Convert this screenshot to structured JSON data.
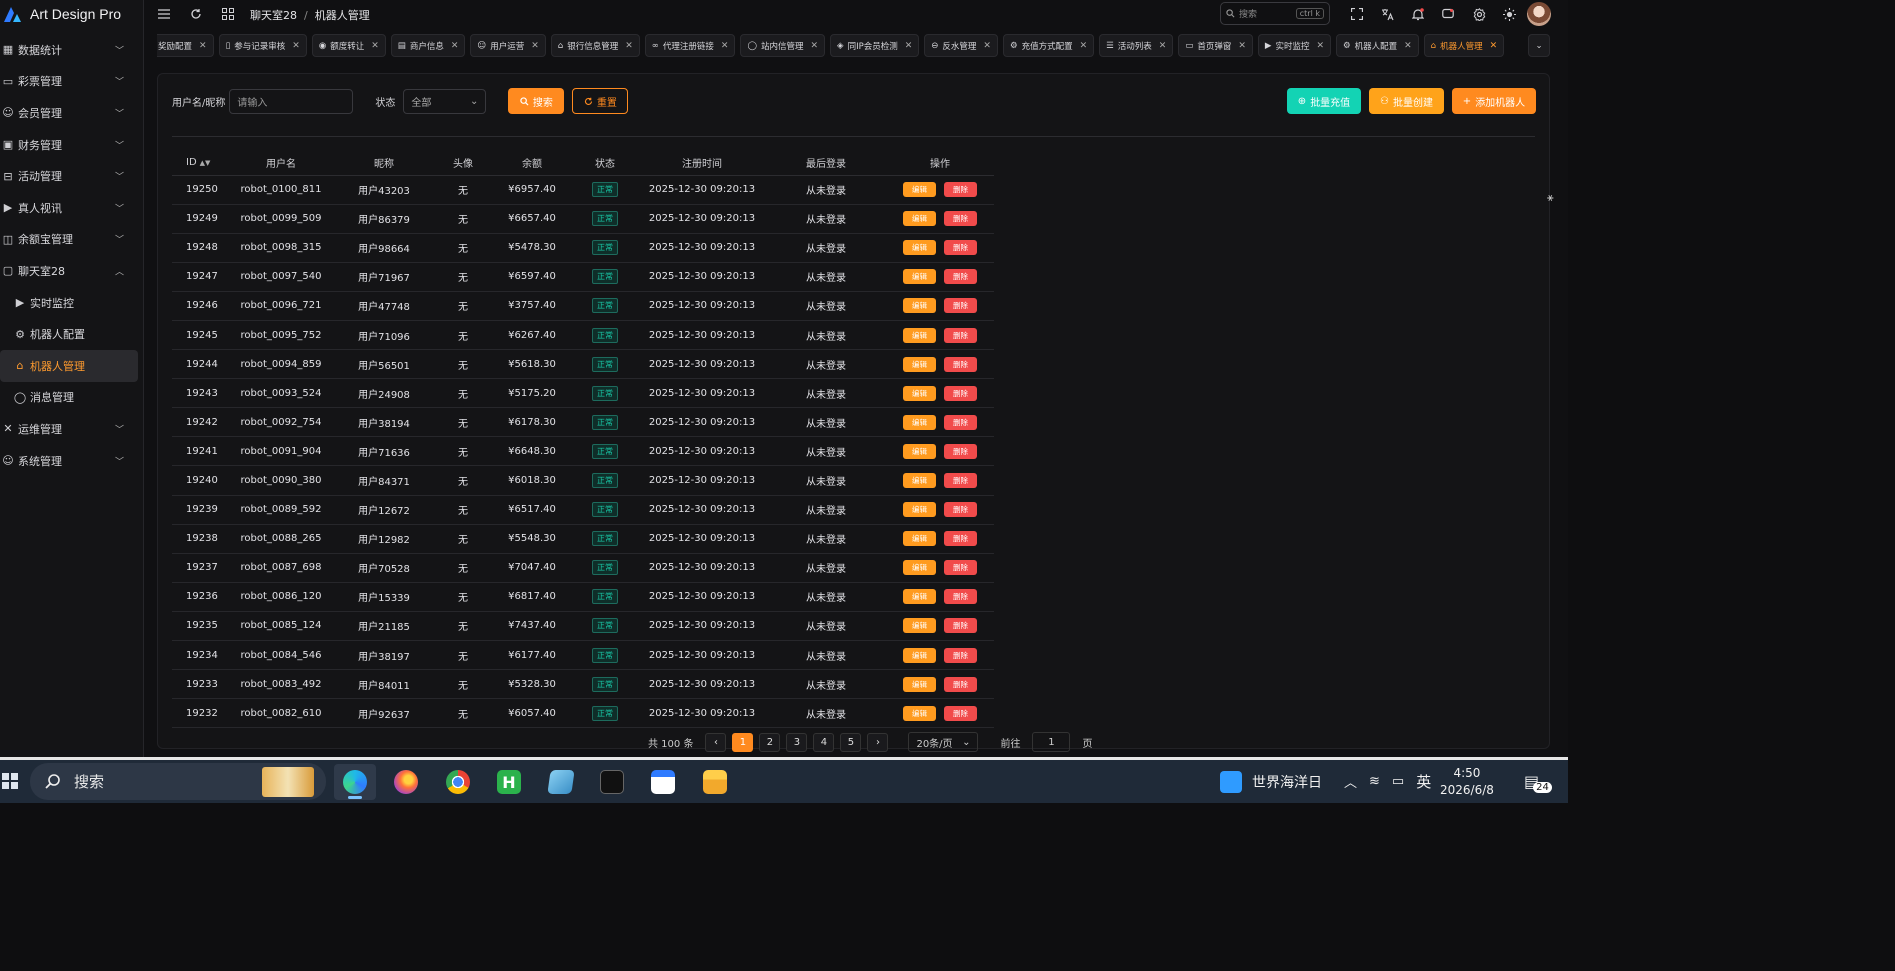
{
  "app": {
    "title": "Art Design Pro"
  },
  "sidebar": {
    "items": [
      {
        "label": "数据统计",
        "icon": "chart-icon",
        "expanded": false,
        "type": "group"
      },
      {
        "label": "彩票管理",
        "icon": "ticket-icon",
        "expanded": false,
        "type": "group"
      },
      {
        "label": "会员管理",
        "icon": "user-icon",
        "expanded": false,
        "type": "group"
      },
      {
        "label": "财务管理",
        "icon": "wallet-icon",
        "expanded": false,
        "type": "group"
      },
      {
        "label": "活动管理",
        "icon": "gift-icon",
        "expanded": false,
        "type": "group"
      },
      {
        "label": "真人视讯",
        "icon": "video-icon",
        "expanded": false,
        "type": "group"
      },
      {
        "label": "余额宝管理",
        "icon": "piggy-icon",
        "expanded": false,
        "type": "group"
      },
      {
        "label": "聊天室28",
        "icon": "chat-room-icon",
        "expanded": true,
        "type": "group"
      },
      {
        "label": "实时监控",
        "icon": "monitor-icon",
        "type": "sub"
      },
      {
        "label": "机器人配置",
        "icon": "gear-icon",
        "type": "sub"
      },
      {
        "label": "机器人管理",
        "icon": "robot-icon",
        "type": "sub",
        "active": true
      },
      {
        "label": "消息管理",
        "icon": "message-icon",
        "type": "sub"
      },
      {
        "label": "运维管理",
        "icon": "tools-icon",
        "expanded": false,
        "type": "group"
      },
      {
        "label": "系统管理",
        "icon": "system-user-icon",
        "expanded": false,
        "type": "group"
      }
    ]
  },
  "header": {
    "breadcrumb": [
      "聊天室28",
      "机器人管理"
    ],
    "search_placeholder": "搜索",
    "search_shortcut": "ctrl k"
  },
  "tabs": [
    {
      "label": "奖励配置",
      "icon": ""
    },
    {
      "label": "参与记录审核",
      "icon": "doc-icon"
    },
    {
      "label": "额度转让",
      "icon": "coin-icon"
    },
    {
      "label": "商户信息",
      "icon": "card-icon"
    },
    {
      "label": "用户运营",
      "icon": "user-icon"
    },
    {
      "label": "银行信息管理",
      "icon": "bank-icon"
    },
    {
      "label": "代理注册链接",
      "icon": "link-icon"
    },
    {
      "label": "站内信管理",
      "icon": "message-icon"
    },
    {
      "label": "同IP会员检测",
      "icon": "shield-icon"
    },
    {
      "label": "反水管理",
      "icon": "rebate-icon"
    },
    {
      "label": "充值方式配置",
      "icon": "gear-icon"
    },
    {
      "label": "活动列表",
      "icon": "list-icon"
    },
    {
      "label": "首页弹窗",
      "icon": "window-icon"
    },
    {
      "label": "实时监控",
      "icon": "monitor-icon"
    },
    {
      "label": "机器人配置",
      "icon": "gear-icon"
    },
    {
      "label": "机器人管理",
      "icon": "robot-icon",
      "active": true
    }
  ],
  "filters": {
    "username_label": "用户名/昵称",
    "username_placeholder": "请输入",
    "status_label": "状态",
    "status_value": "全部",
    "search_button": "搜索",
    "reset_button": "重置"
  },
  "actions": {
    "batch_recharge": "批量充值",
    "batch_create": "批量创建",
    "add_robot": "添加机器人"
  },
  "table": {
    "columns": [
      "ID",
      "用户名",
      "昵称",
      "头像",
      "余额",
      "状态",
      "注册时间",
      "最后登录",
      "操作"
    ],
    "edit_label": "编辑",
    "delete_label": "删除",
    "rows": [
      {
        "id": "19250",
        "username": "robot_0100_811",
        "nickname": "用户43203",
        "avatar": "无",
        "balance": "¥6957.40",
        "status": "正常",
        "registered": "2025-12-30 09:20:13",
        "last_login": "从未登录"
      },
      {
        "id": "19249",
        "username": "robot_0099_509",
        "nickname": "用户86379",
        "avatar": "无",
        "balance": "¥6657.40",
        "status": "正常",
        "registered": "2025-12-30 09:20:13",
        "last_login": "从未登录"
      },
      {
        "id": "19248",
        "username": "robot_0098_315",
        "nickname": "用户98664",
        "avatar": "无",
        "balance": "¥5478.30",
        "status": "正常",
        "registered": "2025-12-30 09:20:13",
        "last_login": "从未登录"
      },
      {
        "id": "19247",
        "username": "robot_0097_540",
        "nickname": "用户71967",
        "avatar": "无",
        "balance": "¥6597.40",
        "status": "正常",
        "registered": "2025-12-30 09:20:13",
        "last_login": "从未登录"
      },
      {
        "id": "19246",
        "username": "robot_0096_721",
        "nickname": "用户47748",
        "avatar": "无",
        "balance": "¥3757.40",
        "status": "正常",
        "registered": "2025-12-30 09:20:13",
        "last_login": "从未登录"
      },
      {
        "id": "19245",
        "username": "robot_0095_752",
        "nickname": "用户71096",
        "avatar": "无",
        "balance": "¥6267.40",
        "status": "正常",
        "registered": "2025-12-30 09:20:13",
        "last_login": "从未登录"
      },
      {
        "id": "19244",
        "username": "robot_0094_859",
        "nickname": "用户56501",
        "avatar": "无",
        "balance": "¥5618.30",
        "status": "正常",
        "registered": "2025-12-30 09:20:13",
        "last_login": "从未登录"
      },
      {
        "id": "19243",
        "username": "robot_0093_524",
        "nickname": "用户24908",
        "avatar": "无",
        "balance": "¥5175.20",
        "status": "正常",
        "registered": "2025-12-30 09:20:13",
        "last_login": "从未登录"
      },
      {
        "id": "19242",
        "username": "robot_0092_754",
        "nickname": "用户38194",
        "avatar": "无",
        "balance": "¥6178.30",
        "status": "正常",
        "registered": "2025-12-30 09:20:13",
        "last_login": "从未登录"
      },
      {
        "id": "19241",
        "username": "robot_0091_904",
        "nickname": "用户71636",
        "avatar": "无",
        "balance": "¥6648.30",
        "status": "正常",
        "registered": "2025-12-30 09:20:13",
        "last_login": "从未登录"
      },
      {
        "id": "19240",
        "username": "robot_0090_380",
        "nickname": "用户84371",
        "avatar": "无",
        "balance": "¥6018.30",
        "status": "正常",
        "registered": "2025-12-30 09:20:13",
        "last_login": "从未登录"
      },
      {
        "id": "19239",
        "username": "robot_0089_592",
        "nickname": "用户12672",
        "avatar": "无",
        "balance": "¥6517.40",
        "status": "正常",
        "registered": "2025-12-30 09:20:13",
        "last_login": "从未登录"
      },
      {
        "id": "19238",
        "username": "robot_0088_265",
        "nickname": "用户12982",
        "avatar": "无",
        "balance": "¥5548.30",
        "status": "正常",
        "registered": "2025-12-30 09:20:13",
        "last_login": "从未登录"
      },
      {
        "id": "19237",
        "username": "robot_0087_698",
        "nickname": "用户70528",
        "avatar": "无",
        "balance": "¥7047.40",
        "status": "正常",
        "registered": "2025-12-30 09:20:13",
        "last_login": "从未登录"
      },
      {
        "id": "19236",
        "username": "robot_0086_120",
        "nickname": "用户15339",
        "avatar": "无",
        "balance": "¥6817.40",
        "status": "正常",
        "registered": "2025-12-30 09:20:13",
        "last_login": "从未登录"
      },
      {
        "id": "19235",
        "username": "robot_0085_124",
        "nickname": "用户21185",
        "avatar": "无",
        "balance": "¥7437.40",
        "status": "正常",
        "registered": "2025-12-30 09:20:13",
        "last_login": "从未登录"
      },
      {
        "id": "19234",
        "username": "robot_0084_546",
        "nickname": "用户38197",
        "avatar": "无",
        "balance": "¥6177.40",
        "status": "正常",
        "registered": "2025-12-30 09:20:13",
        "last_login": "从未登录"
      },
      {
        "id": "19233",
        "username": "robot_0083_492",
        "nickname": "用户84011",
        "avatar": "无",
        "balance": "¥5328.30",
        "status": "正常",
        "registered": "2025-12-30 09:20:13",
        "last_login": "从未登录"
      },
      {
        "id": "19232",
        "username": "robot_0082_610",
        "nickname": "用户92637",
        "avatar": "无",
        "balance": "¥6057.40",
        "status": "正常",
        "registered": "2025-12-30 09:20:13",
        "last_login": "从未登录"
      }
    ]
  },
  "pagination": {
    "total": "共 100 条",
    "pages": [
      "1",
      "2",
      "3",
      "4",
      "5"
    ],
    "current": "1",
    "prev": "‹",
    "next": "›",
    "page_size": "20条/页",
    "goto_label": "前往",
    "goto_value": "1",
    "page_suffix": "页"
  },
  "taskbar": {
    "search_text": "搜索",
    "weather_text": "世界海洋日",
    "ime": "英",
    "time": "4:50",
    "date": "2026/6/8",
    "notification_count": "24"
  },
  "colors": {
    "accent": "#ff8a1f",
    "teal": "#13d3b4",
    "danger": "#f14b4b"
  }
}
